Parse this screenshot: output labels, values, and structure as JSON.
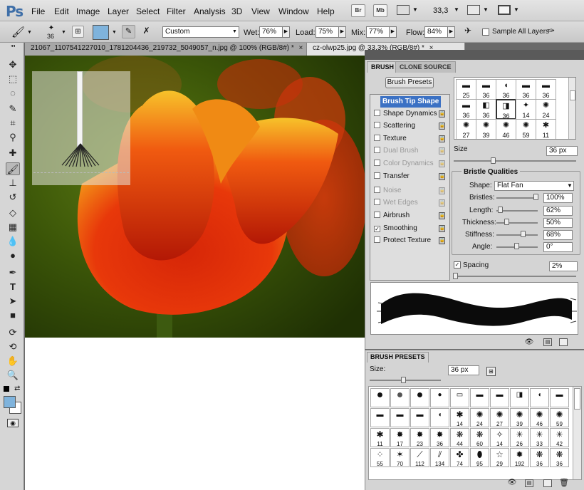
{
  "menubar": {
    "logo": "Ps",
    "items": [
      "File",
      "Edit",
      "Image",
      "Layer",
      "Select",
      "Filter",
      "Analysis",
      "3D",
      "View",
      "Window",
      "Help"
    ],
    "bridge": "Br",
    "minibridge": "Mb",
    "zoom": "33,3"
  },
  "options": {
    "brush_size": "36",
    "preset": "Custom",
    "wet_label": "Wet:",
    "wet_value": "76%",
    "load_label": "Load:",
    "load_value": "75%",
    "mix_label": "Mix:",
    "mix_value": "77%",
    "flow_label": "Flow:",
    "flow_value": "84%",
    "sample_all_layers": "Sample All Layers"
  },
  "doc_tabs": [
    {
      "label": "21067_1107541227010_1781204436_219732_5049057_n.jpg @ 100% (RGB/8#) *",
      "close": "×"
    },
    {
      "label": "cz-olwp25.jpg @ 33,3% (RGB/8#) *",
      "close": "×"
    }
  ],
  "brush_panel": {
    "tabs": [
      "BRUSH",
      "CLONE SOURCE"
    ],
    "presets_button": "Brush Presets",
    "list": [
      {
        "label": "Brush Tip Shape",
        "selected": true,
        "checkbox": false,
        "lock": false
      },
      {
        "label": "Shape Dynamics",
        "checked": false,
        "lock": true
      },
      {
        "label": "Scattering",
        "checked": false,
        "lock": true
      },
      {
        "label": "Texture",
        "checked": false,
        "lock": true
      },
      {
        "label": "Dual Brush",
        "checked": false,
        "lock": true,
        "disabled": true
      },
      {
        "label": "Color Dynamics",
        "checked": false,
        "lock": true,
        "disabled": true
      },
      {
        "label": "Transfer",
        "checked": false,
        "lock": true
      },
      {
        "label": "Noise",
        "checked": false,
        "lock": true,
        "disabled": true
      },
      {
        "label": "Wet Edges",
        "checked": false,
        "lock": true,
        "disabled": true
      },
      {
        "label": "Airbrush",
        "checked": false,
        "lock": true
      },
      {
        "label": "Smoothing",
        "checked": true,
        "lock": true
      },
      {
        "label": "Protect Texture",
        "checked": false,
        "lock": true
      }
    ],
    "tip_grid": [
      "25",
      "36",
      "36",
      "36",
      "36",
      "36",
      "36",
      "36",
      "14",
      "24",
      "27",
      "39",
      "46",
      "59",
      "11"
    ],
    "size_label": "Size",
    "size_value": "36 px",
    "bristle_title": "Bristle Qualities",
    "shape_label": "Shape:",
    "shape_value": "Flat Fan",
    "bristles_label": "Bristles:",
    "bristles_value": "100%",
    "length_label": "Length:",
    "length_value": "62%",
    "thickness_label": "Thickness:",
    "thickness_value": "50%",
    "stiffness_label": "Stiffness:",
    "stiffness_value": "68%",
    "angle_label": "Angle:",
    "angle_value": "0°",
    "spacing_label": "Spacing",
    "spacing_value": "2%"
  },
  "presets_panel": {
    "title": "BRUSH PRESETS",
    "size_label": "Size:",
    "size_value": "36 px",
    "numbers": [
      "",
      "",
      "",
      "",
      "",
      "",
      "",
      "",
      "",
      "",
      "",
      "",
      "",
      "",
      "",
      "14",
      "24",
      "27",
      "39",
      "46",
      "59",
      "11",
      "17",
      "23",
      "36",
      "44",
      "60",
      "14",
      "26",
      "33",
      "42",
      "55",
      "70",
      "112",
      "134",
      "74",
      "95",
      "29",
      "192",
      "36",
      "36"
    ]
  }
}
